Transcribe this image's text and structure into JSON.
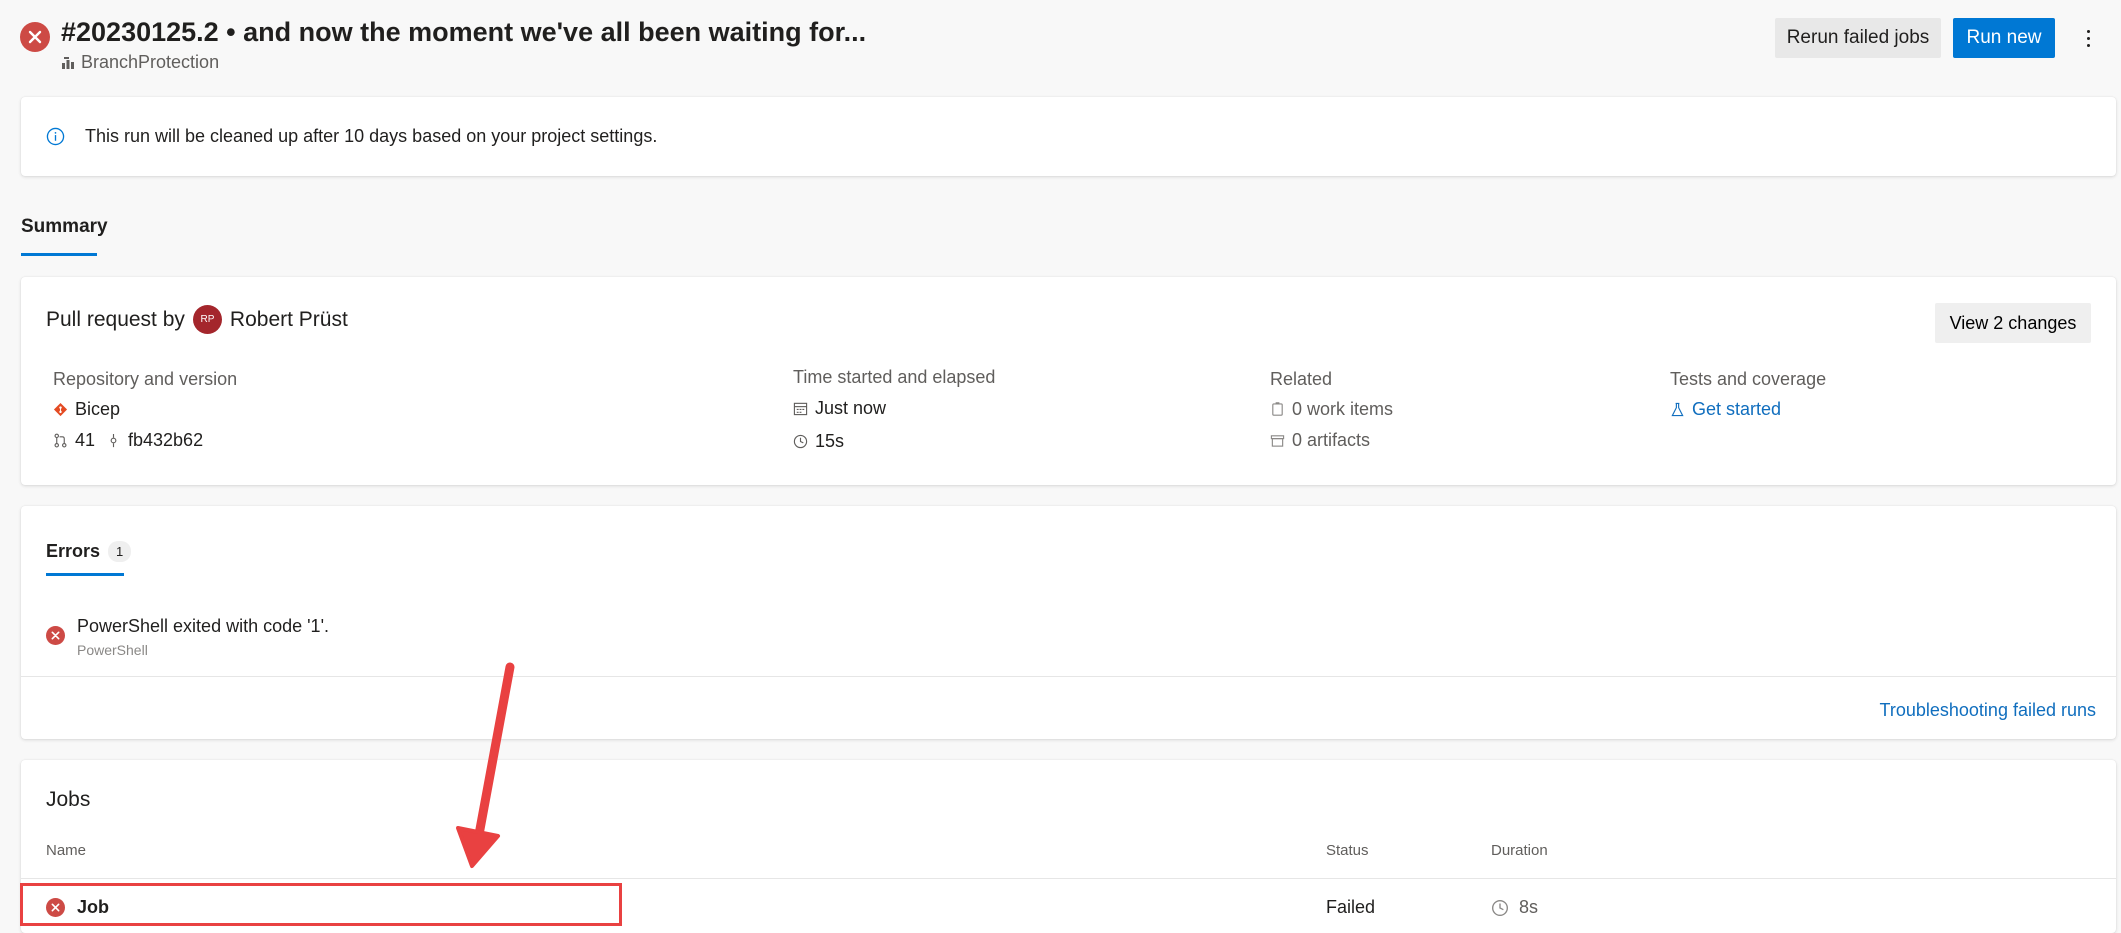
{
  "header": {
    "run_title": "#20230125.2 • and now the moment we've all been waiting for...",
    "pipeline_name": "BranchProtection",
    "rerun_label": "Rerun failed jobs",
    "run_new_label": "Run new"
  },
  "banner": {
    "text": "This run will be cleaned up after 10 days based on your project settings."
  },
  "tabs": {
    "summary": "Summary"
  },
  "summary": {
    "pr_prefix": "Pull request by",
    "author_initials": "RP",
    "author_name": "Robert Prüst",
    "view_changes": "View 2 changes",
    "repo_label": "Repository and version",
    "repo_name": "Bicep",
    "pr_number": "41",
    "commit": "fb432b62",
    "time_label": "Time started and elapsed",
    "started": "Just now",
    "elapsed": "15s",
    "related_label": "Related",
    "work_items": "0 work items",
    "artifacts": "0 artifacts",
    "tests_label": "Tests and coverage",
    "get_started": "Get started"
  },
  "errors": {
    "tab_label": "Errors",
    "count": "1",
    "message": "PowerShell exited with code '1'.",
    "source": "PowerShell",
    "troubleshoot": "Troubleshooting failed runs"
  },
  "jobs": {
    "heading": "Jobs",
    "columns": {
      "name": "Name",
      "status": "Status",
      "duration": "Duration"
    },
    "rows": [
      {
        "name": "Job",
        "status": "Failed",
        "duration": "8s"
      }
    ]
  },
  "colors": {
    "accent": "#0078d4",
    "failure": "#cd4a45",
    "annotation": "#e94141"
  }
}
